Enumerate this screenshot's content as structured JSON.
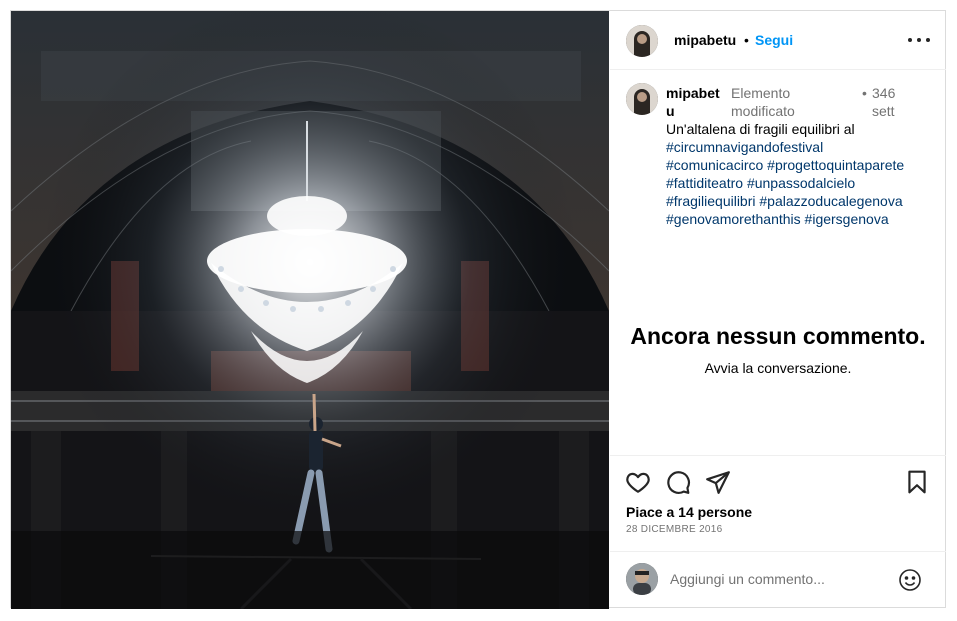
{
  "post": {
    "username": "mipabetu",
    "header_separator": "•",
    "follow_label": "Segui",
    "caption": {
      "username": "mipabetu",
      "edited_label": "Elemento modificato",
      "separator": "•",
      "age": "346 sett",
      "text": "Un'altalena di fragili equilibri al",
      "hashtags": [
        "#circumnavigandofestival",
        "#comunicacirco",
        "#progettoquintaparete",
        "#fattiditeatro",
        "#unpassodalcielo",
        "#fragiliequilibri",
        "#palazzoducalegenova",
        "#genovamorethanthis",
        "#igersgenova"
      ]
    },
    "empty_comments": {
      "title": "Ancora nessun commento.",
      "subtitle": "Avvia la conversazione."
    },
    "likes_label": "Piace a 14 persone",
    "date_label": "28 DICEMBRE 2016",
    "add_comment_placeholder": "Aggiungi un commento...",
    "icons": {
      "like": "heart-icon",
      "comment": "comment-icon",
      "share": "send-icon",
      "save": "bookmark-icon",
      "more": "more-horizontal-icon",
      "emoji": "emoji-icon"
    },
    "colors": {
      "follow": "#0095f6",
      "hashtag": "#00376b",
      "muted": "#737373",
      "border": "#dbdbdb"
    }
  }
}
